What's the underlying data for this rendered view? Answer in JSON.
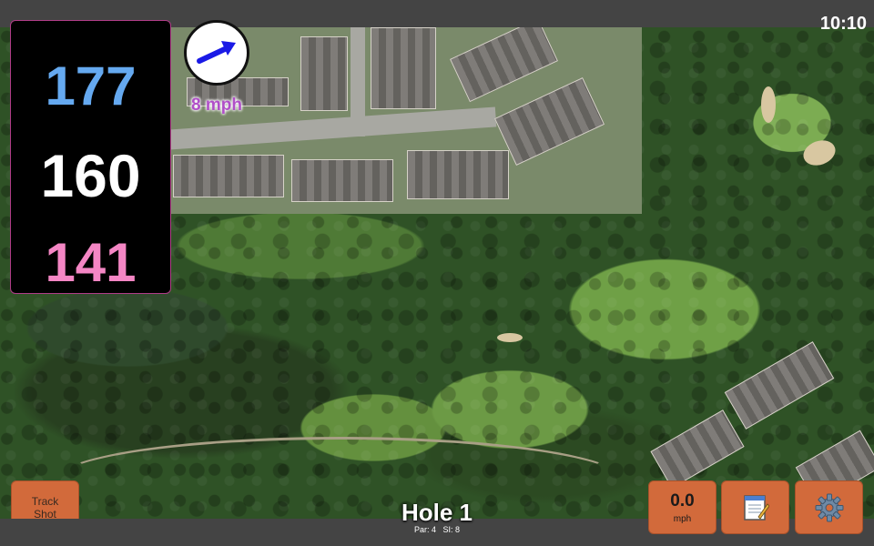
{
  "status": {
    "time": "10:10"
  },
  "yardages": {
    "back": "177",
    "center": "160",
    "front": "141"
  },
  "wind": {
    "speed_label": "8 mph",
    "direction_icon": "wind-arrow-icon",
    "arrow_color": "#1a1ae6"
  },
  "buttons": {
    "track_shot": "Track\nShot",
    "speed_value": "0.0",
    "speed_unit": "mph",
    "notes_icon": "notepad-icon",
    "settings_icon": "gear-icon"
  },
  "hole": {
    "title": "Hole 1",
    "par": "Par: 4",
    "si": "SI: 8"
  },
  "colors": {
    "back_yardage": "#65a9f0",
    "center_yardage": "#ffffff",
    "front_yardage": "#f486c4",
    "button_accent": "#d26a3b"
  }
}
